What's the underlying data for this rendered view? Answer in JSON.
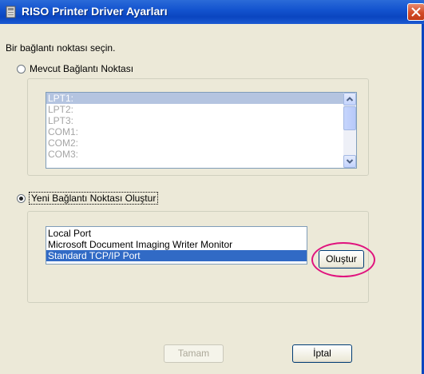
{
  "window": {
    "title": "RISO Printer Driver Ayarları",
    "close_icon": "close-icon",
    "app_icon": "printer-icon"
  },
  "instruction": "Bir bağlantı noktası seçin.",
  "existing_port": {
    "label": "Mevcut Bağlantı Noktası",
    "selected": false,
    "items": [
      {
        "label": "LPT1:"
      },
      {
        "label": "LPT2:"
      },
      {
        "label": "LPT3:"
      },
      {
        "label": "COM1:"
      },
      {
        "label": "COM2:"
      },
      {
        "label": "COM3:"
      }
    ]
  },
  "new_port": {
    "label": "Yeni Bağlantı Noktası Oluştur",
    "selected": true,
    "items": [
      {
        "label": "Local Port"
      },
      {
        "label": "Microsoft Document Imaging Writer Monitor"
      },
      {
        "label": "Standard TCP/IP Port"
      }
    ],
    "create_button": "Oluştur"
  },
  "buttons": {
    "ok": "Tamam",
    "cancel": "İptal"
  },
  "colors": {
    "highlight_ring": "#e0137e",
    "selection": "#316ac5"
  }
}
